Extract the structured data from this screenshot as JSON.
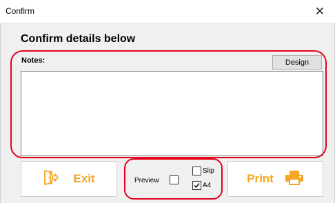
{
  "window": {
    "title": "Confirm",
    "close_glyph": "✕"
  },
  "heading": "Confirm details below",
  "notes": {
    "label": "Notes:",
    "value": "",
    "design_button": "Design"
  },
  "buttons": {
    "exit": "Exit",
    "print": "Print"
  },
  "options": {
    "preview_label": "Preview",
    "preview_checked": false,
    "slip_label": "Slip",
    "slip_checked": false,
    "a4_label": "A4",
    "a4_checked": true
  },
  "colors": {
    "accent": "#f5a623",
    "highlight": "#e5001c"
  },
  "icons": {
    "exit": "exit-door-icon",
    "print": "printer-icon"
  }
}
